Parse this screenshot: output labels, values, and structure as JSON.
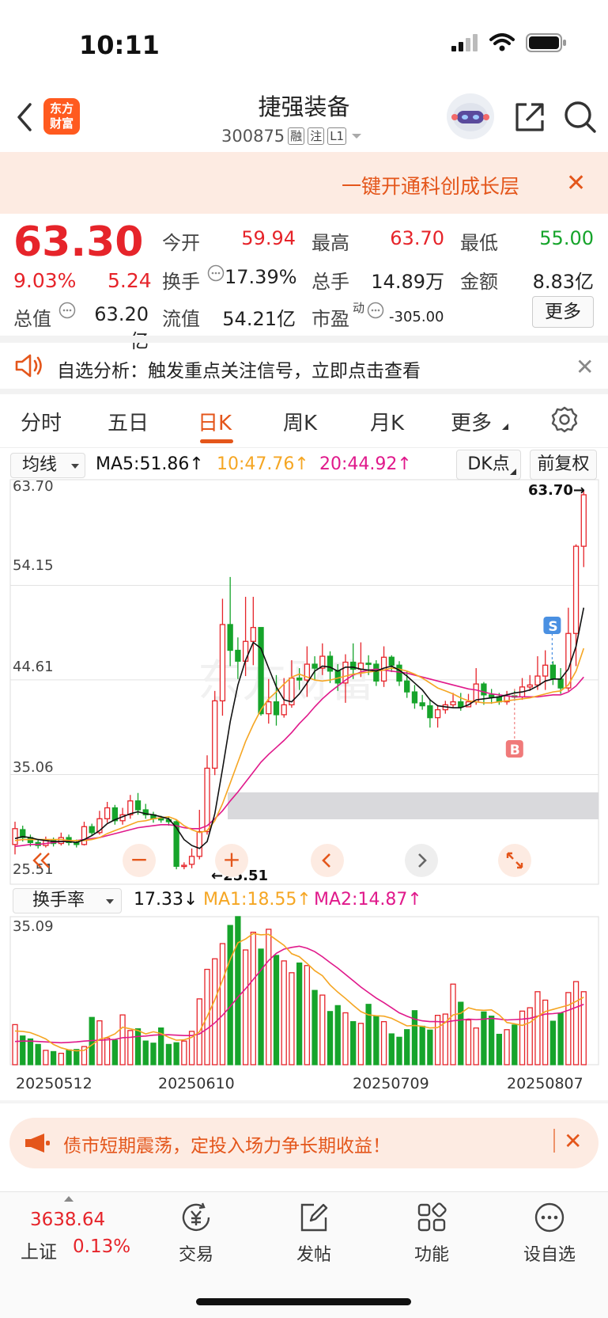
{
  "status_bar": {
    "time": "10:11"
  },
  "header": {
    "logo_text_1": "东方",
    "logo_text_2": "财富",
    "stock_name": "捷强装备",
    "stock_code": "300875",
    "tags": [
      "融",
      "注",
      "L1"
    ]
  },
  "banner": {
    "text": "一键开通科创成长层"
  },
  "quote": {
    "price": "63.30",
    "pct": "9.03%",
    "change": "5.24",
    "open_label": "今开",
    "open": "59.94",
    "high_label": "最高",
    "high": "63.70",
    "low_label": "最低",
    "low": "55.00",
    "turnover_label": "换手",
    "turnover": "17.39%",
    "volume_label": "总手",
    "volume": "14.89万",
    "amount_label": "金额",
    "amount": "8.83亿",
    "mktcap_label": "总值",
    "mktcap": "63.20亿",
    "float_label": "流值",
    "float": "54.21亿",
    "pe_label": "市盈",
    "pe_sup": "动",
    "pe": "-305.00",
    "more": "更多"
  },
  "analysis": {
    "text": "自选分析：触发重点关注信号，立即点击查看"
  },
  "tabs": [
    "分时",
    "五日",
    "日K",
    "周K",
    "月K",
    "更多"
  ],
  "active_tab": "日K",
  "ma_row": {
    "select": "均线",
    "ma5": "MA5:51.86↑",
    "ma10": "10:47.76↑",
    "ma20": "20:44.92↑",
    "dk_btn": "DK点",
    "fq_btn": "前复权"
  },
  "sub_row": {
    "select": "换手率",
    "value": "17.33↓",
    "ma1": "MA1:18.55↑",
    "ma2": "MA2:14.87↑"
  },
  "chart_data": {
    "type": "candlestick",
    "price_axis_labels": [
      "63.70",
      "54.15",
      "44.61",
      "35.06",
      "25.51"
    ],
    "max_label": "63.70→",
    "min_label": "←25.51",
    "turnover_axis_label": "35.09",
    "date_labels": [
      "20250512",
      "20250610",
      "20250709",
      "20250807"
    ],
    "colors": {
      "up": "#e6242a",
      "down": "#16a42b",
      "ma5": "#111111",
      "ma10": "#f5a623",
      "ma20": "#e0198b"
    },
    "candles": [
      [
        28.0,
        29.6,
        27.0,
        30.3
      ],
      [
        29.5,
        28.7,
        28.3,
        29.9
      ],
      [
        28.7,
        28.2,
        27.8,
        29.0
      ],
      [
        28.2,
        27.9,
        27.6,
        28.5
      ],
      [
        27.9,
        28.4,
        27.7,
        28.8
      ],
      [
        28.4,
        28.1,
        27.8,
        28.7
      ],
      [
        28.1,
        28.7,
        27.9,
        29.2
      ],
      [
        28.7,
        28.2,
        27.9,
        29.0
      ],
      [
        28.2,
        28.0,
        27.7,
        28.5
      ],
      [
        28.0,
        29.8,
        27.9,
        30.3
      ],
      [
        29.8,
        29.2,
        28.9,
        30.1
      ],
      [
        29.2,
        30.6,
        29.0,
        31.4
      ],
      [
        30.6,
        31.7,
        30.2,
        32.3
      ],
      [
        31.7,
        30.4,
        30.0,
        32.0
      ],
      [
        30.4,
        31.0,
        30.0,
        31.7
      ],
      [
        31.0,
        32.4,
        30.6,
        33.0
      ],
      [
        32.4,
        31.5,
        31.0,
        33.2
      ],
      [
        31.5,
        31.0,
        30.6,
        32.1
      ],
      [
        31.0,
        30.6,
        30.2,
        31.3
      ],
      [
        30.6,
        30.5,
        30.2,
        30.9
      ],
      [
        30.5,
        30.3,
        29.9,
        30.8
      ],
      [
        30.3,
        25.8,
        25.5,
        30.5
      ],
      [
        25.8,
        25.9,
        25.5,
        26.2
      ],
      [
        26.0,
        26.8,
        25.6,
        27.6
      ],
      [
        26.8,
        29.3,
        26.5,
        31.5
      ],
      [
        29.3,
        35.7,
        29.0,
        37.0
      ],
      [
        35.7,
        42.5,
        35.0,
        43.5
      ],
      [
        42.5,
        50.2,
        41.0,
        52.8
      ],
      [
        50.2,
        47.6,
        46.0,
        55.0
      ],
      [
        47.6,
        46.5,
        44.7,
        48.9
      ],
      [
        46.5,
        48.5,
        45.0,
        53.0
      ],
      [
        48.5,
        49.9,
        46.1,
        53.0
      ],
      [
        49.9,
        41.2,
        41.0,
        46.2
      ],
      [
        41.2,
        42.4,
        40.2,
        44.7
      ],
      [
        42.4,
        41.1,
        40.0,
        45.1
      ],
      [
        41.1,
        42.1,
        40.8,
        44.8
      ],
      [
        42.1,
        44.8,
        41.8,
        46.6
      ],
      [
        44.8,
        44.6,
        43.6,
        45.8
      ],
      [
        44.6,
        46.2,
        42.9,
        48.0
      ],
      [
        46.2,
        45.8,
        44.6,
        47.0
      ],
      [
        45.8,
        47.0,
        45.1,
        48.3
      ],
      [
        47.0,
        45.5,
        44.3,
        47.5
      ],
      [
        45.5,
        44.3,
        43.5,
        46.2
      ],
      [
        44.3,
        46.4,
        42.3,
        47.2
      ],
      [
        46.4,
        45.7,
        44.7,
        48.3
      ],
      [
        45.7,
        46.3,
        44.9,
        48.4
      ],
      [
        46.3,
        46.2,
        45.1,
        47.1
      ],
      [
        46.2,
        44.5,
        44.0,
        46.6
      ],
      [
        44.5,
        46.9,
        43.9,
        48.0
      ],
      [
        46.9,
        46.1,
        45.4,
        47.1
      ],
      [
        46.1,
        44.5,
        44.0,
        46.5
      ],
      [
        44.5,
        43.4,
        42.8,
        45.5
      ],
      [
        43.4,
        42.3,
        41.7,
        44.1
      ],
      [
        42.3,
        42.0,
        41.6,
        43.1
      ],
      [
        42.0,
        40.8,
        39.8,
        42.7
      ],
      [
        40.8,
        41.6,
        39.8,
        42.1
      ],
      [
        41.6,
        42.1,
        41.2,
        42.5
      ],
      [
        42.1,
        42.4,
        41.8,
        43.3
      ],
      [
        42.4,
        41.9,
        41.5,
        43.3
      ],
      [
        41.9,
        42.4,
        41.9,
        43.2
      ],
      [
        42.4,
        44.2,
        42.1,
        45.8
      ],
      [
        44.2,
        43.1,
        42.1,
        44.4
      ],
      [
        43.1,
        42.9,
        42.2,
        43.7
      ],
      [
        42.9,
        42.4,
        42.1,
        43.3
      ],
      [
        42.4,
        43.0,
        42.1,
        43.5
      ],
      [
        43.0,
        42.9,
        42.5,
        43.6
      ],
      [
        42.9,
        43.9,
        42.6,
        44.8
      ],
      [
        43.9,
        44.1,
        43.5,
        45.1
      ],
      [
        44.1,
        45.0,
        43.6,
        47.0
      ],
      [
        45.0,
        46.1,
        43.6,
        47.6
      ],
      [
        46.1,
        44.7,
        44.1,
        46.5
      ],
      [
        44.7,
        43.8,
        43.2,
        45.8
      ],
      [
        43.8,
        49.3,
        43.5,
        51.9
      ],
      [
        49.3,
        58.1,
        46.0,
        58.3
      ],
      [
        58.1,
        63.3,
        56.0,
        63.7
      ]
    ],
    "ma5_series": [
      28.6,
      28.8,
      28.7,
      28.5,
      28.4,
      28.3,
      28.3,
      28.3,
      28.2,
      28.5,
      28.9,
      29.4,
      30.1,
      30.5,
      30.8,
      31.1,
      31.3,
      31.1,
      31.0,
      30.8,
      30.6,
      29.7,
      28.5,
      27.9,
      27.6,
      28.3,
      31.1,
      35.6,
      40.4,
      44.1,
      46.6,
      48.4,
      47.8,
      45.8,
      43.9,
      42.6,
      42.4,
      43.2,
      44.3,
      45.5,
      46.0,
      45.9,
      45.5,
      45.9,
      45.9,
      45.7,
      45.6,
      45.5,
      45.8,
      46.0,
      45.6,
      45.0,
      44.3,
      43.6,
      42.6,
      42.0,
      41.9,
      41.8,
      41.8,
      42.1,
      42.6,
      42.7,
      42.8,
      42.9,
      43.1,
      43.3,
      43.4,
      43.6,
      44.0,
      44.5,
      44.7,
      44.7,
      45.7,
      48.0,
      51.9
    ],
    "ma10_series": [
      28.4,
      28.5,
      28.5,
      28.5,
      28.5,
      28.5,
      28.5,
      28.4,
      28.4,
      28.4,
      28.5,
      28.7,
      29.1,
      29.4,
      29.7,
      30.0,
      30.3,
      30.4,
      30.6,
      30.7,
      30.8,
      30.5,
      29.9,
      29.5,
      29.2,
      29.4,
      30.4,
      32.1,
      34.2,
      36.3,
      38.4,
      40.1,
      41.6,
      42.7,
      43.4,
      44.2,
      44.9,
      45.2,
      44.9,
      44.6,
      44.5,
      44.6,
      44.8,
      45.0,
      45.2,
      45.3,
      45.4,
      45.5,
      45.6,
      45.8,
      45.7,
      45.5,
      45.2,
      44.8,
      44.3,
      43.8,
      43.5,
      43.2,
      42.8,
      42.5,
      42.4,
      42.3,
      42.3,
      42.4,
      42.5,
      42.6,
      42.7,
      42.8,
      43.0,
      43.2,
      43.4,
      43.5,
      44.1,
      45.5,
      47.8
    ],
    "ma20_series": [
      27.8,
      27.9,
      28.0,
      28.0,
      28.1,
      28.2,
      28.3,
      28.4,
      28.4,
      28.5,
      28.6,
      28.7,
      28.9,
      29.1,
      29.3,
      29.5,
      29.7,
      29.8,
      29.9,
      30.0,
      30.0,
      29.9,
      29.7,
      29.6,
      29.6,
      29.9,
      30.6,
      31.4,
      32.4,
      33.3,
      34.3,
      35.3,
      36.3,
      37.1,
      37.8,
      38.5,
      39.3,
      40.2,
      41.0,
      41.9,
      42.7,
      43.4,
      44.0,
      44.6,
      45.1,
      45.4,
      45.6,
      45.7,
      45.6,
      45.5,
      45.4,
      45.3,
      45.1,
      44.9,
      44.7,
      44.5,
      44.3,
      44.1,
      43.9,
      43.7,
      43.6,
      43.4,
      43.2,
      43.1,
      43.0,
      42.9,
      42.9,
      42.9,
      42.9,
      43.0,
      43.1,
      43.1,
      43.4,
      44.0,
      44.9
    ],
    "turnover": [
      9.5,
      6.8,
      6.1,
      4.8,
      3.4,
      3.1,
      2.7,
      3.5,
      3.6,
      4.3,
      11.2,
      10.4,
      6.3,
      5.8,
      11.8,
      8.1,
      8.5,
      5.6,
      5.1,
      8.7,
      4.8,
      5.2,
      5.6,
      7.9,
      15.6,
      22.6,
      25.1,
      28.7,
      33.0,
      35.1,
      27.2,
      31.4,
      27.4,
      32.1,
      25.9,
      24.6,
      21.8,
      24.1,
      23.5,
      17.6,
      16.5,
      12.6,
      14.0,
      12.3,
      10.2,
      9.8,
      14.3,
      11.5,
      10.2,
      7.3,
      6.5,
      8.3,
      12.8,
      9.1,
      8.2,
      11.7,
      12.0,
      19.1,
      14.8,
      10.6,
      8.7,
      12.5,
      11.5,
      7.2,
      8.3,
      9.4,
      12.7,
      13.5,
      17.3,
      15.3,
      10.3,
      12.2,
      17.1,
      19.7,
      17.3
    ],
    "turnover_ma1": [
      8.0,
      7.9,
      7.6,
      6.9,
      6.1,
      4.8,
      4.0,
      3.5,
      3.3,
      3.4,
      4.7,
      6.0,
      6.5,
      7.3,
      8.9,
      8.5,
      8.1,
      7.3,
      7.8,
      7.4,
      6.5,
      5.8,
      5.9,
      6.5,
      7.8,
      11.4,
      15.4,
      20.0,
      25.0,
      28.9,
      29.8,
      31.1,
      30.8,
      30.9,
      29.6,
      28.3,
      26.3,
      25.6,
      24.0,
      22.3,
      21.1,
      18.9,
      17.2,
      15.7,
      14.1,
      12.6,
      11.8,
      11.6,
      11.5,
      11.0,
      10.1,
      9.2,
      9.3,
      9.1,
      8.7,
      8.8,
      10.0,
      11.8,
      12.2,
      13.5,
      13.0,
      12.9,
      13.0,
      11.8,
      10.0,
      9.7,
      9.3,
      10.0,
      11.4,
      12.6,
      13.1,
      13.6,
      14.1,
      15.0,
      16.0
    ],
    "turnover_ma2": [
      5.5,
      5.6,
      5.6,
      5.5,
      5.4,
      5.3,
      5.2,
      5.3,
      5.4,
      5.6,
      5.7,
      5.8,
      5.9,
      6.0,
      6.4,
      6.5,
      6.7,
      6.8,
      7.0,
      7.1,
      7.1,
      7.0,
      6.9,
      6.9,
      7.3,
      8.5,
      9.9,
      11.7,
      13.8,
      16.0,
      18.0,
      20.2,
      22.4,
      24.7,
      26.4,
      27.4,
      27.8,
      28.1,
      27.6,
      26.8,
      25.6,
      24.2,
      22.9,
      21.4,
      19.9,
      18.4,
      17.1,
      15.8,
      14.7,
      13.5,
      12.3,
      11.5,
      10.8,
      10.4,
      10.2,
      10.2,
      10.1,
      10.4,
      10.6,
      10.8,
      10.7,
      10.8,
      11.0,
      10.8,
      10.6,
      10.7,
      10.8,
      11.0,
      11.5,
      12.0,
      12.1,
      12.3,
      12.9,
      13.6,
      14.3
    ]
  },
  "signals": {
    "s_label": "S",
    "b_label": "B"
  },
  "ad": {
    "text": "债市短期震荡，定投入场力争长期收益！"
  },
  "bottom_nav": {
    "index_value": "3638.64",
    "index_name": "上证",
    "index_pct": "0.13%",
    "items": [
      "交易",
      "发帖",
      "功能",
      "设自选"
    ]
  }
}
